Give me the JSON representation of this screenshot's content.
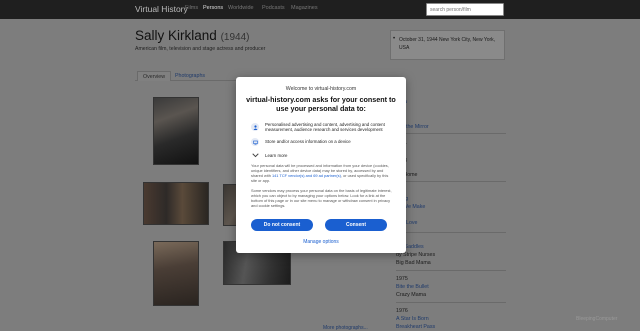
{
  "navbar": {
    "brand": "Virtual History",
    "links": [
      "Films",
      "Persons",
      "Worldwide",
      "Podcasts",
      "Magazines"
    ],
    "search_placeholder": "search person/film"
  },
  "person": {
    "name": "Sally Kirkland",
    "year": "(1944)",
    "description": "American film, television and stage actress and producer",
    "bio_line": "October 31, 1944 New York City, New York, USA"
  },
  "tabs": [
    "Overview",
    "Photographs"
  ],
  "more_photos": "More photographs...",
  "sidebar": {
    "entries": [
      {
        "text": "a",
        "kind": "film"
      },
      {
        "text": "e in the Mirror",
        "kind": "film"
      },
      {
        "text": "1",
        "kind": "year"
      },
      {
        "text": "8",
        "kind": "year"
      },
      {
        "text": "ng Home",
        "kind": "plain"
      },
      {
        "text": "Sting",
        "kind": "film"
      },
      {
        "text": "nk We Make",
        "kind": "film"
      },
      {
        "text": "w",
        "kind": "film"
      },
      {
        "text": "e in Love",
        "kind": "film"
      },
      {
        "text": "ing Saddles",
        "kind": "film"
      },
      {
        "text": "dy Stripe Nurses",
        "kind": "plain"
      },
      {
        "text": "Big Bad Mama",
        "kind": "plain"
      },
      {
        "text": "1975",
        "kind": "year"
      },
      {
        "text": "Bite the Bullet",
        "kind": "film"
      },
      {
        "text": "Crazy Mama",
        "kind": "plain"
      },
      {
        "text": "1976",
        "kind": "year"
      },
      {
        "text": "A Star Is Born",
        "kind": "film"
      },
      {
        "text": "Breakheart Pass",
        "kind": "film"
      }
    ]
  },
  "consent": {
    "welcome": "Welcome to virtual-history.com",
    "heading": "virtual-history.com asks for your consent to use your personal data to:",
    "item1": "Personalised advertising and content, advertising and content measurement, audience research and services development",
    "item2": "Store and/or access information on a device",
    "learn_more": "Learn more",
    "para1_a": "Your personal data will be processed and information from your device (cookies, unique identifiers, and other device data) may be stored by, accessed by and shared with ",
    "para1_link": "141 TCF vendor(s) and 69 ad partner(s)",
    "para1_b": ", or used specifically by this site or app.",
    "para2": "Some vendors may process your personal data on the basis of legitimate interest, which you can object to by managing your options below. Look for a link at the bottom of this page or in our site menu to manage or withdraw consent in privacy and cookie settings.",
    "btn_no": "Do not consent",
    "btn_yes": "Consent",
    "manage": "Manage options"
  },
  "watermark": "BleepingComputer"
}
